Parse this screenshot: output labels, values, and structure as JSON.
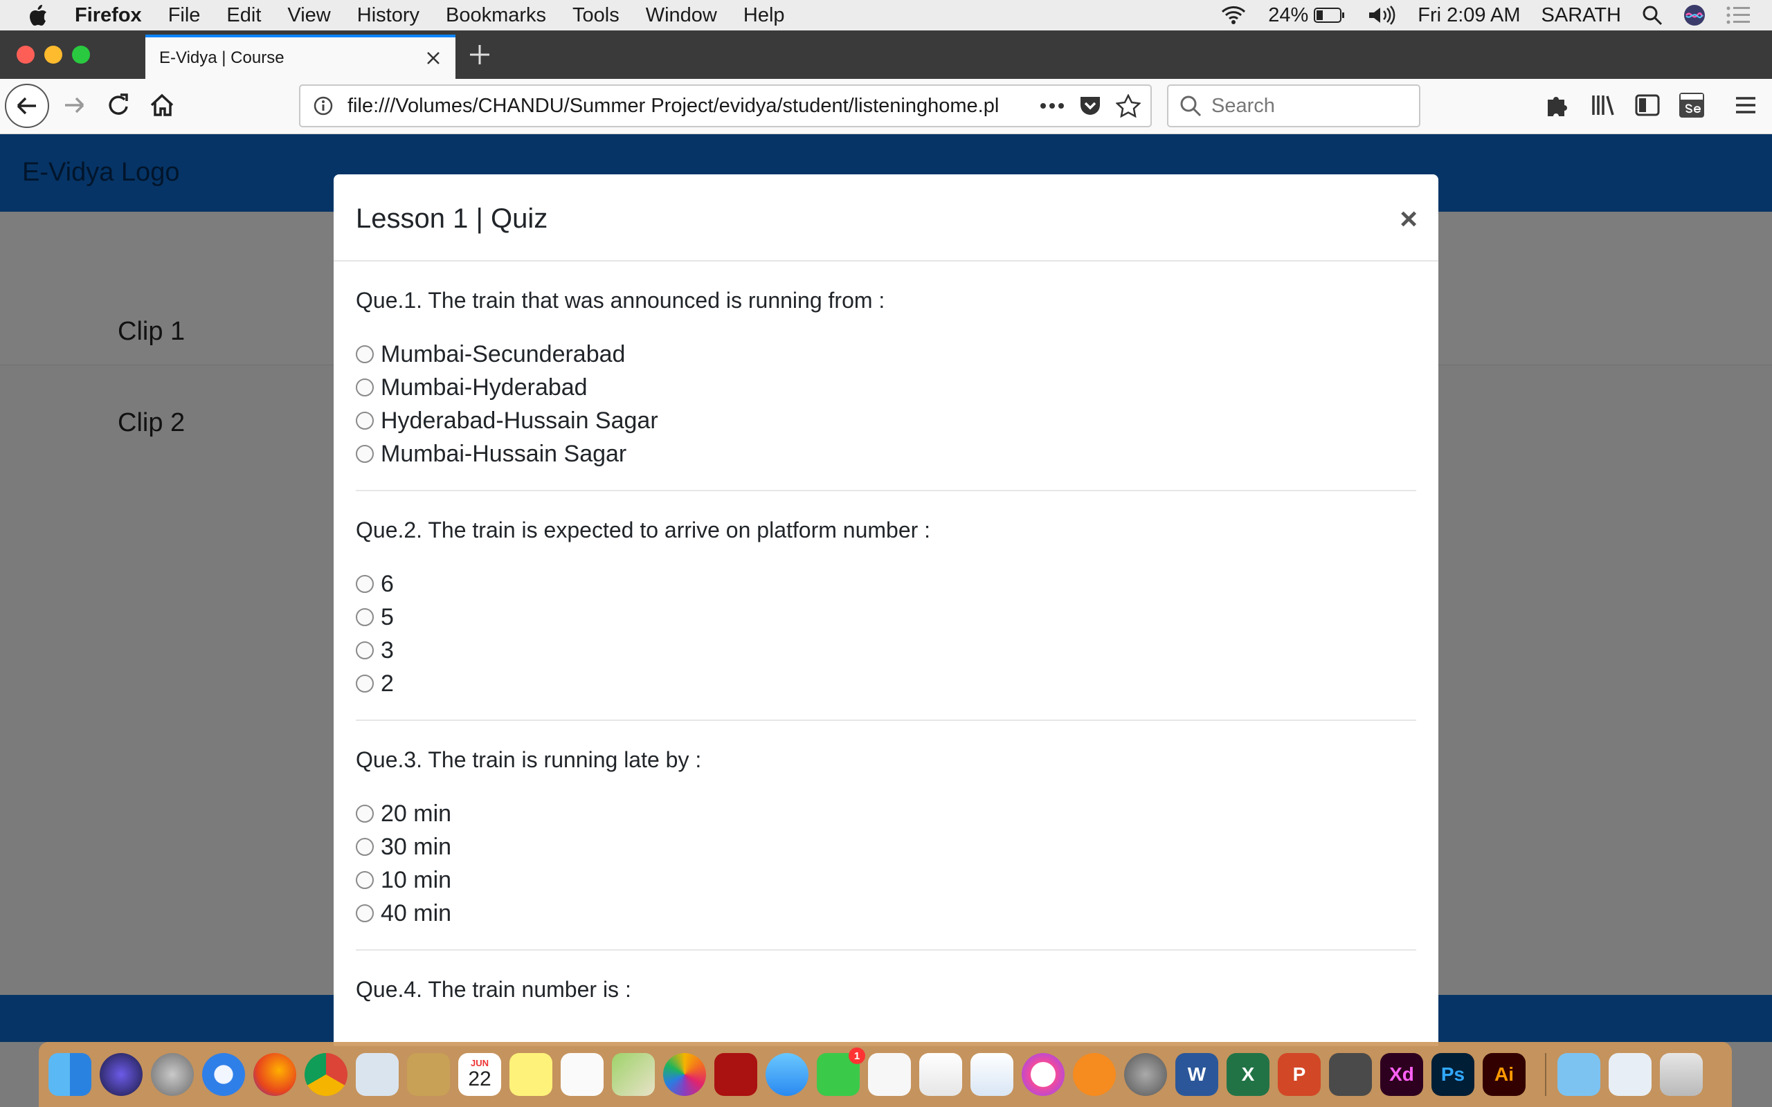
{
  "menubar": {
    "app_name": "Firefox",
    "items": [
      "File",
      "Edit",
      "View",
      "History",
      "Bookmarks",
      "Tools",
      "Window",
      "Help"
    ],
    "battery": "24%",
    "clock": "Fri 2:09 AM",
    "user": "SARATH"
  },
  "browser": {
    "tab_title": "E-Vidya | Course",
    "url": "file:///Volumes/CHANDU/Summer Project/evidya/student/listeninghome.pl",
    "search_placeholder": "Search"
  },
  "page": {
    "logo": "E-Vidya Logo",
    "clips": [
      "Clip 1",
      "Clip 2"
    ]
  },
  "modal": {
    "title": "Lesson 1 | Quiz",
    "close_symbol": "×",
    "questions": [
      {
        "text": "Que.1. The train that was announced is running from :",
        "options": [
          "Mumbai-Secunderabad",
          "Mumbai-Hyderabad",
          "Hyderabad-Hussain Sagar",
          "Mumbai-Hussain Sagar"
        ]
      },
      {
        "text": "Que.2. The train is expected to arrive on platform number :",
        "options": [
          "6",
          "5",
          "3",
          "2"
        ]
      },
      {
        "text": "Que.3. The train is running late by :",
        "options": [
          "20 min",
          "30 min",
          "10 min",
          "40 min"
        ]
      },
      {
        "text": "Que.4. The train number is :",
        "options": []
      }
    ]
  },
  "dock": {
    "icons": [
      "finder-icon",
      "siri-icon",
      "launchpad-icon",
      "safari-icon",
      "firefox-icon",
      "chrome-icon",
      "mail-icon",
      "notes-icon",
      "calendar-icon",
      "stickies-icon",
      "reminders-icon",
      "maps-icon",
      "photos-icon",
      "photobooth-icon",
      "messages-icon",
      "facetime-icon",
      "textedit-icon",
      "numbers-icon",
      "keynote-icon",
      "itunes-icon",
      "ibooks-icon",
      "system-preferences-icon",
      "word-icon",
      "excel-icon",
      "powerpoint-icon",
      "sublime-icon",
      "xd-icon",
      "photoshop-icon",
      "illustrator-icon",
      "folder-icon",
      "documents-icon",
      "trash-icon"
    ],
    "calendar_month": "JUN",
    "calendar_day": "22",
    "facetime_badge": "1",
    "word_letter": "W",
    "excel_letter": "X",
    "powerpoint_letter": "P",
    "xd_label": "Xd",
    "ps_label": "Ps",
    "ai_label": "Ai"
  },
  "colors": {
    "site_header": "#063466",
    "overlay_page": "#7b7b7b",
    "tab_accent": "#0a84ff"
  }
}
